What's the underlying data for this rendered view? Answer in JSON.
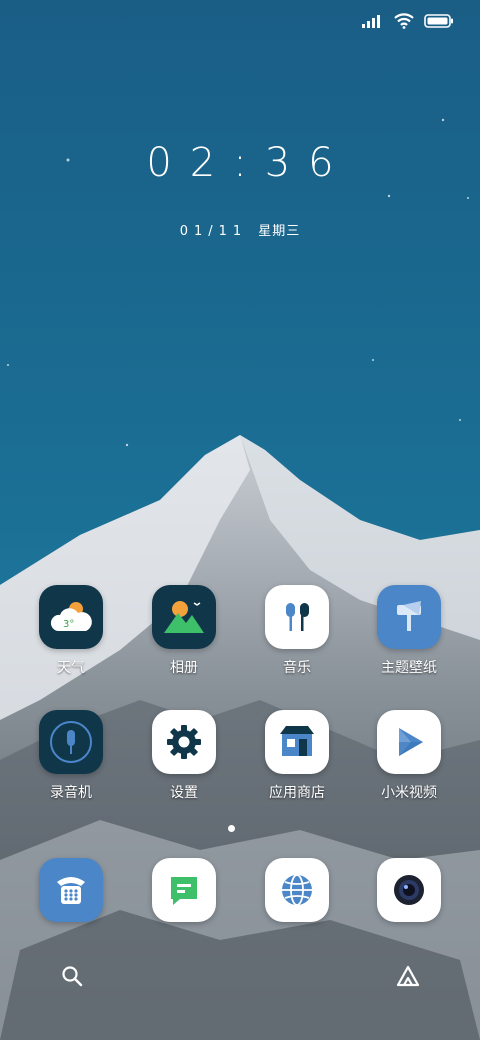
{
  "status_icons": [
    "signal-icon",
    "wifi-icon",
    "battery-icon"
  ],
  "clock": "02:36",
  "date": {
    "day": "01/11",
    "weekday": "星期三"
  },
  "apps_row1": [
    {
      "name": "天气",
      "badge": "3°"
    },
    {
      "name": "相册"
    },
    {
      "name": "音乐"
    },
    {
      "name": "主题壁纸"
    }
  ],
  "apps_row2": [
    {
      "name": "录音机"
    },
    {
      "name": "设置"
    },
    {
      "name": "应用商店"
    },
    {
      "name": "小米视频"
    }
  ],
  "dock": [
    "phone-app",
    "messages-app",
    "browser-app",
    "camera-app"
  ],
  "bottom": [
    "search-icon",
    "assistant-icon"
  ],
  "colors": {
    "sky": "#1b6f94",
    "accent_blue": "#4a86c8",
    "dark_icon": "#10364a",
    "green": "#3ec06a"
  }
}
